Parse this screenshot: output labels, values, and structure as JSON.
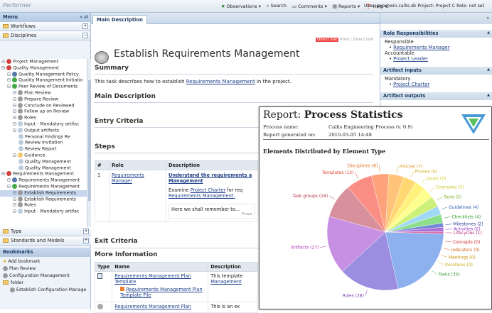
{
  "app": {
    "logo": "Performer"
  },
  "toolbar": {
    "observations": "Observations",
    "search": "Search",
    "comments": "Comments",
    "reports": "Reports",
    "help": "Help",
    "user_info": "User: pvp@win.callis.dk  Project: Project C  Role: not set"
  },
  "left": {
    "menu_title": "Menu",
    "workflows": "Workflows",
    "disciplines": "Disciplines",
    "tree": [
      {
        "label": "Project Management",
        "indent": 0,
        "color": "#c44"
      },
      {
        "label": "Quality Management",
        "indent": 0,
        "color": "#c44"
      },
      {
        "label": "Quality Management Policy",
        "indent": 1,
        "color": "#57a"
      },
      {
        "label": "Quality Management Initiatio",
        "indent": 1,
        "color": "#4a4"
      },
      {
        "label": "Peer Review of Documents",
        "indent": 1,
        "color": "#4a4"
      },
      {
        "label": "Plan Review",
        "indent": 2,
        "color": "#999"
      },
      {
        "label": "Prepare Review",
        "indent": 2,
        "color": "#999"
      },
      {
        "label": "Conclude on Reviewed",
        "indent": 2,
        "color": "#999"
      },
      {
        "label": "Follow up on Review",
        "indent": 2,
        "color": "#999"
      },
      {
        "label": "Roles",
        "indent": 2,
        "color": "#999"
      },
      {
        "label": "Input - Mandatory artifac",
        "indent": 2,
        "color": "#bcd"
      },
      {
        "label": "Output artifacts",
        "indent": 2,
        "color": "#bcd"
      },
      {
        "label": "Personal Findings Re",
        "indent": 3,
        "color": "#bcd"
      },
      {
        "label": "Review Invitation",
        "indent": 3,
        "color": "#bcd"
      },
      {
        "label": "Review Report",
        "indent": 3,
        "color": "#bcd"
      },
      {
        "label": "Guidance",
        "indent": 2,
        "color": "#f3c968"
      },
      {
        "label": "Quality Management",
        "indent": 3,
        "color": "#bcd"
      },
      {
        "label": "Quality Management",
        "indent": 3,
        "color": "#bcd"
      },
      {
        "label": "Requirements Management",
        "indent": 0,
        "color": "#c44"
      },
      {
        "label": "Requirements Management",
        "indent": 1,
        "color": "#57a"
      },
      {
        "label": "Requirements Management",
        "indent": 1,
        "color": "#4a4"
      },
      {
        "label": "Establish Requirements",
        "indent": 2,
        "color": "#999",
        "selected": true
      },
      {
        "label": "Establish Requirements",
        "indent": 2,
        "color": "#999"
      },
      {
        "label": "Roles",
        "indent": 2,
        "color": "#999"
      },
      {
        "label": "Input - Mandatory artifac",
        "indent": 2,
        "color": "#bcd"
      }
    ],
    "type": "Type",
    "standards": "Standards and Models",
    "bookmarks_title": "Bookmarks",
    "add_bookmark": "Add bookmark",
    "bookmarks": [
      {
        "label": "Plan Review",
        "indent": 0
      },
      {
        "label": "Configuration Management",
        "indent": 0
      },
      {
        "label": "folder",
        "indent": 0,
        "folder": true
      },
      {
        "label": "Establish Configuration Manage",
        "indent": 1
      }
    ]
  },
  "main": {
    "tab": "Main Description",
    "top_links": "Print | Direct link",
    "red_badge": "Direct link",
    "title": "Establish Requirements Management",
    "summary_h": "Summary",
    "summary_pre": "This task describes how to establish ",
    "summary_link": "Requirements Management",
    "summary_post": " in the project.",
    "main_desc_h": "Main Description",
    "entry_h": "Entry Criteria",
    "steps_h": "Steps",
    "steps_cols": [
      "#",
      "Role",
      "Description"
    ],
    "step_num": "1",
    "step_role_1": "Requirements",
    "step_role_2": "Manager",
    "step_desc_1": "Understand the requirements a",
    "step_desc_2": "Management",
    "step_desc_3a": "Examine ",
    "step_desc_3link": "Project Charter",
    "step_desc_3b": " for req",
    "step_desc_4": "Requirements Management.",
    "step_desc_5": "Here we shall remember to...",
    "step_desc_6": "Prope",
    "exit_h": "Exit Criteria",
    "more_h": "More Information",
    "more_cols": [
      "Type",
      "Name",
      "Description"
    ],
    "more_name_1": "Requirements Management Plan",
    "more_name_2": "Template",
    "more_sub_1": "Requirements Management Plan",
    "more_sub_2": "Template File",
    "more_desc_1": "This template",
    "more_desc_2": "Management",
    "more_name_3": "Requirements Management Plan",
    "more_desc_3": "This is an ex"
  },
  "right": {
    "resp_h": "Role Responsibilities",
    "responsible": "Responsible",
    "resp_link": "Requirements Manager",
    "accountable": "Accountable",
    "acc_link": "Project Leader",
    "inputs_h": "Artifact inputs",
    "mandatory": "Mandatory",
    "charter": "Project Charter",
    "outputs_h": "Artifact outputs"
  },
  "report": {
    "title_pre": "Report: ",
    "title_bold": "Process Statistics",
    "process_label": "Process name:",
    "process_value": "Callis Engineering Process (v. 0.9)",
    "generated_label": "Report generated on:",
    "generated_value": "2010-03-05 14:48",
    "subtitle": "Elements Distributed by Element Type"
  },
  "chart_data": {
    "type": "pie",
    "title": "Elements Distributed by Element Type",
    "slices": [
      {
        "label": "Tasks",
        "value": 35,
        "color": "#8db0ee",
        "text": "#3a9a3a"
      },
      {
        "label": "Roles",
        "value": 28,
        "color": "#9b8ee0",
        "text": "#7b3fb0"
      },
      {
        "label": "Artifacts",
        "value": 27,
        "color": "#c890e2",
        "text": "#b030b0"
      },
      {
        "label": "Task groups",
        "value": 16,
        "color": "#d8909c",
        "text": "#b03048"
      },
      {
        "label": "Templates",
        "value": 12,
        "color": "#fb8e84",
        "text": "#e04030"
      },
      {
        "label": "Disciplines",
        "value": 8,
        "color": "#fda27a",
        "text": "#e06a20"
      },
      {
        "label": "Policies",
        "value": 7,
        "color": "#ffc37a",
        "text": "#e09a20"
      },
      {
        "label": "Phases",
        "value": 6,
        "color": "#ffd874",
        "text": "#d8b020"
      },
      {
        "label": "Goals",
        "value": 5,
        "color": "#fff27c",
        "text": "#d8c828"
      },
      {
        "label": "Examples",
        "value": 5,
        "color": "#ffff90",
        "text": "#c8c830"
      },
      {
        "label": "Tools",
        "value": 5,
        "color": "#ccf078",
        "text": "#78a820"
      },
      {
        "label": "Guidelines",
        "value": 4,
        "color": "#a0d8f8",
        "text": "#2a5ab0"
      },
      {
        "label": "Checklists",
        "value": 4,
        "color": "#8ce08c",
        "text": "#2a9a2a"
      },
      {
        "label": "Milestones",
        "value": 2,
        "color": "#7488d8",
        "text": "#2a3a9a"
      },
      {
        "label": "Activities",
        "value": 2,
        "color": "#b070d8",
        "text": "#9030c0"
      },
      {
        "label": "Lifecycles",
        "value": 1,
        "color": "#d870a8",
        "text": "#b02878"
      },
      {
        "label": "Concepts",
        "value": 0,
        "color": "#e85858",
        "text": "#d02020"
      },
      {
        "label": "Indicators",
        "value": 0,
        "color": "#f89050",
        "text": "#d06010"
      },
      {
        "label": "Meetings",
        "value": 0,
        "color": "#f8c050",
        "text": "#c89010"
      },
      {
        "label": "Iterations",
        "value": 0,
        "color": "#f8e050",
        "text": "#c8a810"
      }
    ]
  }
}
